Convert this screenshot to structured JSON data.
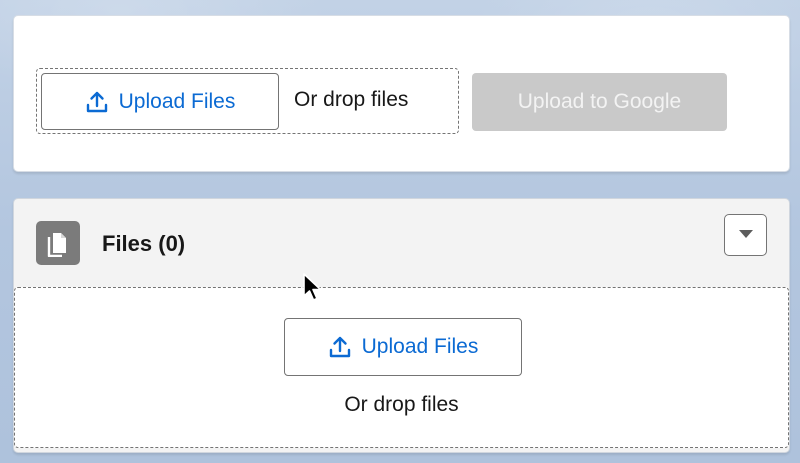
{
  "upload_section": {
    "upload_button_label": "Upload Files",
    "drop_text": "Or drop files",
    "google_button_label": "Upload to Google"
  },
  "files_section": {
    "title": "Files (0)",
    "upload_button_label": "Upload Files",
    "drop_text": "Or drop files"
  },
  "icons": {
    "upload": "upload-icon",
    "files": "files-icon",
    "menu": "chevron-down-icon",
    "cursor": "mouse-pointer-icon"
  },
  "colors": {
    "link_blue": "#0b6ad3",
    "disabled_button_bg": "#c9c9c9",
    "disabled_button_text": "#f3f3f3",
    "files_icon_bg": "#7b7b7b",
    "card_header_bg": "#f3f3f3",
    "page_bg": "#b7c8de"
  }
}
